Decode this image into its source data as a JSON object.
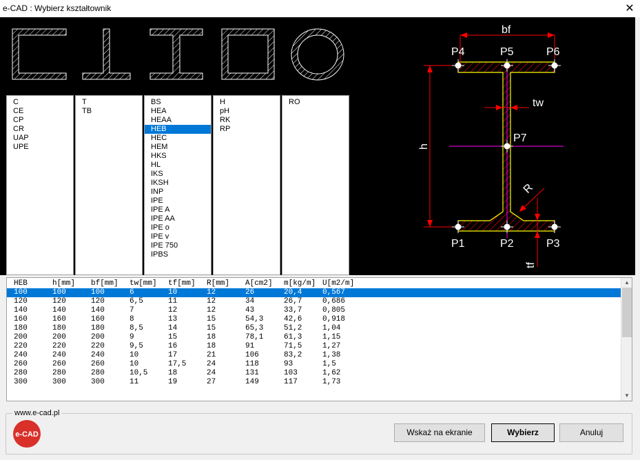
{
  "window": {
    "title": "e-CAD : Wybierz kształtownik",
    "close_glyph": "✕"
  },
  "colors": {
    "hatch": "#ff0000",
    "dim": "#ff0000",
    "axis": "#ff00ff",
    "outline": "#ffff00",
    "shapes": "#ffffff",
    "selection": "#0078d7",
    "logo": "#d9302a"
  },
  "drawing": {
    "labels": {
      "bf": "bf",
      "tw": "tw",
      "h": "h",
      "R": "R",
      "tf": "tf",
      "P1": "P1",
      "P2": "P2",
      "P3": "P3",
      "P4": "P4",
      "P5": "P5",
      "P6": "P6",
      "P7": "P7"
    }
  },
  "lists": [
    {
      "id": "c",
      "items": [
        "C",
        "CE",
        "CP",
        "CR",
        "UAP",
        "UPE"
      ],
      "selected": -1
    },
    {
      "id": "t",
      "items": [
        "T",
        "TB"
      ],
      "selected": -1
    },
    {
      "id": "i",
      "items": [
        "BS",
        "HEA",
        "HEAA",
        "HEB",
        "HEC",
        "HEM",
        "HKS",
        "HL",
        "IKS",
        "IKSH",
        "INP",
        "IPE",
        "IPE A",
        "IPE AA",
        "IPE o",
        "IPE v",
        "IPE 750",
        "IPBS"
      ],
      "selected": 3
    },
    {
      "id": "h",
      "items": [
        "H",
        "pH",
        "RK",
        "RP"
      ],
      "selected": -1
    },
    {
      "id": "o",
      "items": [
        "RO"
      ],
      "selected": -1
    }
  ],
  "table": {
    "columns": [
      "HEB",
      "h[mm]",
      "bf[mm]",
      "tw[mm]",
      "tf[mm]",
      "R[mm]",
      "A[cm2]",
      "m[kg/m]",
      "U[m2/m]"
    ],
    "rows": [
      [
        "100",
        "100",
        "100",
        "6",
        "10",
        "12",
        "26",
        "20,4",
        "0,567"
      ],
      [
        "120",
        "120",
        "120",
        "6,5",
        "11",
        "12",
        "34",
        "26,7",
        "0,686"
      ],
      [
        "140",
        "140",
        "140",
        "7",
        "12",
        "12",
        "43",
        "33,7",
        "0,805"
      ],
      [
        "160",
        "160",
        "160",
        "8",
        "13",
        "15",
        "54,3",
        "42,6",
        "0,918"
      ],
      [
        "180",
        "180",
        "180",
        "8,5",
        "14",
        "15",
        "65,3",
        "51,2",
        "1,04"
      ],
      [
        "200",
        "200",
        "200",
        "9",
        "15",
        "18",
        "78,1",
        "61,3",
        "1,15"
      ],
      [
        "220",
        "220",
        "220",
        "9,5",
        "16",
        "18",
        "91",
        "71,5",
        "1,27"
      ],
      [
        "240",
        "240",
        "240",
        "10",
        "17",
        "21",
        "106",
        "83,2",
        "1,38"
      ],
      [
        "260",
        "260",
        "260",
        "10",
        "17,5",
        "24",
        "118",
        "93",
        "1,5"
      ],
      [
        "280",
        "280",
        "280",
        "10,5",
        "18",
        "24",
        "131",
        "103",
        "1,62"
      ],
      [
        "300",
        "300",
        "300",
        "11",
        "19",
        "27",
        "149",
        "117",
        "1,73"
      ]
    ],
    "selected_row": 0,
    "scroll_up": "▲",
    "scroll_down": "▼"
  },
  "footer": {
    "site": "www.e-cad.pl",
    "logo_text": "e-CAD",
    "buttons": {
      "pick": "Wskaż na ekranie",
      "choose": "Wybierz",
      "cancel": "Anuluj"
    }
  }
}
